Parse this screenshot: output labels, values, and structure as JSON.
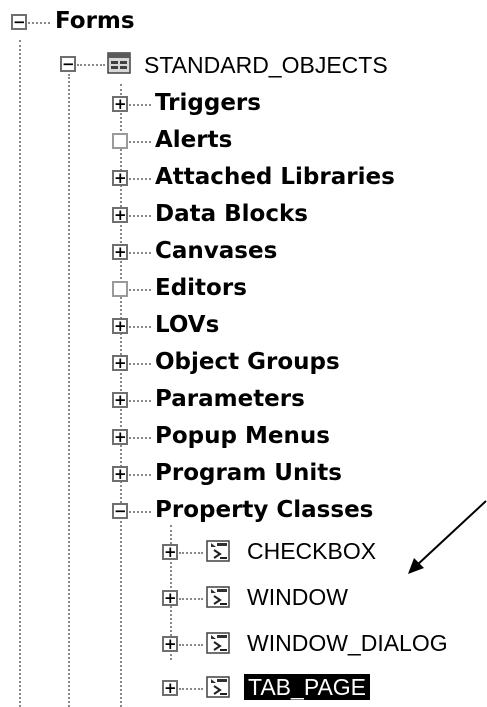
{
  "tree": {
    "root": {
      "label": "Forms",
      "state": "collapse"
    },
    "module": {
      "label": "STANDARD_OBJECTS",
      "icon": "form-module-icon",
      "state": "collapse"
    },
    "nodes": [
      {
        "label": "Triggers",
        "state": "expand"
      },
      {
        "label": "Alerts",
        "state": "empty"
      },
      {
        "label": "Attached Libraries",
        "state": "expand"
      },
      {
        "label": "Data Blocks",
        "state": "expand"
      },
      {
        "label": "Canvases",
        "state": "expand"
      },
      {
        "label": "Editors",
        "state": "empty"
      },
      {
        "label": "LOVs",
        "state": "expand"
      },
      {
        "label": "Object Groups",
        "state": "expand"
      },
      {
        "label": "Parameters",
        "state": "expand"
      },
      {
        "label": "Popup Menus",
        "state": "expand"
      },
      {
        "label": "Program Units",
        "state": "expand"
      },
      {
        "label": "Property Classes",
        "state": "collapse"
      }
    ],
    "property_classes": [
      {
        "label": "CHECKBOX",
        "icon": "property-class-icon",
        "state": "expand"
      },
      {
        "label": "WINDOW",
        "icon": "property-class-icon",
        "state": "expand"
      },
      {
        "label": "WINDOW_DIALOG",
        "icon": "property-class-icon",
        "state": "expand"
      },
      {
        "label": "TAB_PAGE",
        "icon": "property-class-icon",
        "state": "expand",
        "selected": true
      }
    ]
  },
  "annotation": {
    "type": "arrow",
    "points_to": "CHECKBOX"
  },
  "colors": {
    "selection_bg": "#000000",
    "selection_fg": "#ffffff",
    "connector": "#8a8a8a"
  }
}
